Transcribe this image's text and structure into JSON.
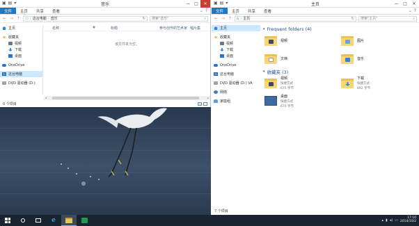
{
  "left_window": {
    "title": "音乐",
    "ribbon_tabs": [
      "文件",
      "主页",
      "共享",
      "查看"
    ],
    "address_crumbs": [
      "这台电脑",
      "音乐"
    ],
    "search_placeholder": "搜索\"音乐\"",
    "nav": {
      "home": "主页",
      "favorites": "收藏夹",
      "fav_items": [
        "视频",
        "下载",
        "桌面"
      ],
      "onedrive": "OneDrive",
      "this_pc": "这台电脑",
      "dvd": "DVD 驱动器 (D:)"
    },
    "columns": [
      "名称",
      "#",
      "标题",
      "参与创作的艺术家",
      "唱片集"
    ],
    "empty_message": "该文件夹为空。",
    "status": "0 个项目"
  },
  "right_window": {
    "title": "主页",
    "ribbon_tabs": [
      "文件",
      "主页",
      "共享",
      "查看"
    ],
    "address_crumbs": [
      "主页"
    ],
    "search_placeholder": "搜索\"主页\"",
    "nav": {
      "home": "主页",
      "favorites": "收藏夹",
      "fav_items": [
        "视频",
        "下载",
        "桌面"
      ],
      "onedrive": "OneDrive",
      "this_pc": "这台电脑",
      "dvd": "DVD 驱动器 (D:) VA",
      "network": "网络",
      "homegroup": "家庭组"
    },
    "frequent_header": "Frequent folders (4)",
    "frequent": [
      "视频",
      "图片",
      "文档",
      "音乐"
    ],
    "favorites_header": "收藏夹 (3)",
    "favorites": [
      {
        "name": "视频",
        "type": "快捷方式",
        "size": "675 字节"
      },
      {
        "name": "下载",
        "type": "快捷方式",
        "size": "892 字节"
      },
      {
        "name": "桌面",
        "type": "快捷方式",
        "size": "675 字节"
      }
    ],
    "status": "7 个项目"
  },
  "taskbar": {
    "time": "17:10",
    "date": "2014/10/2"
  },
  "icons": {
    "back": "arrow-left-icon",
    "forward": "arrow-right-icon",
    "up": "arrow-up-icon",
    "refresh": "refresh-icon",
    "search": "search-icon"
  }
}
